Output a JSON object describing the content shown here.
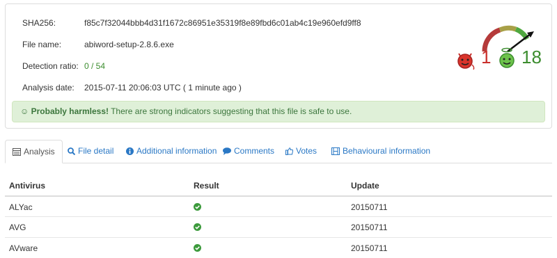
{
  "file_info": {
    "sha256_label": "SHA256:",
    "sha256_value": "f85c7f32044bbb4d31f1672c86951e35319f8e89fbd6c01ab4c19e960efd9ff8",
    "filename_label": "File name:",
    "filename_value": "abiword-setup-2.8.6.exe",
    "ratio_label": "Detection ratio:",
    "ratio_value": "0 / 54",
    "date_label": "Analysis date:",
    "date_value": "2015-07-11 20:06:03 UTC ( 1 minute ago )"
  },
  "verdict": {
    "bold": "Probably harmless!",
    "text": " There are strong indicators suggesting that this file is safe to use.",
    "icon": "smile-icon"
  },
  "votes": {
    "malicious": "1",
    "harmless": "18",
    "gauge_level": 0.75,
    "colors": {
      "bad": "#c9302c",
      "good": "#3c8d2f"
    }
  },
  "tabs": [
    {
      "label": "Analysis",
      "icon": "table-icon",
      "active": true
    },
    {
      "label": "File detail",
      "icon": "search-icon"
    },
    {
      "label": "Additional information",
      "icon": "info-icon"
    },
    {
      "label": "Comments",
      "icon": "comment-icon"
    },
    {
      "label": "Votes",
      "icon": "thumbs-icon"
    },
    {
      "label": "Behavioural information",
      "icon": "film-icon"
    }
  ],
  "table": {
    "headers": [
      "Antivirus",
      "Result",
      "Update"
    ],
    "rows": [
      {
        "antivirus": "ALYac",
        "result": "clean",
        "update": "20150711"
      },
      {
        "antivirus": "AVG",
        "result": "clean",
        "update": "20150711"
      },
      {
        "antivirus": "AVware",
        "result": "clean",
        "update": "20150711"
      }
    ]
  },
  "colors": {
    "link": "#2a78c5",
    "success_bg": "#dff0d8",
    "success_text": "#3c763d"
  }
}
